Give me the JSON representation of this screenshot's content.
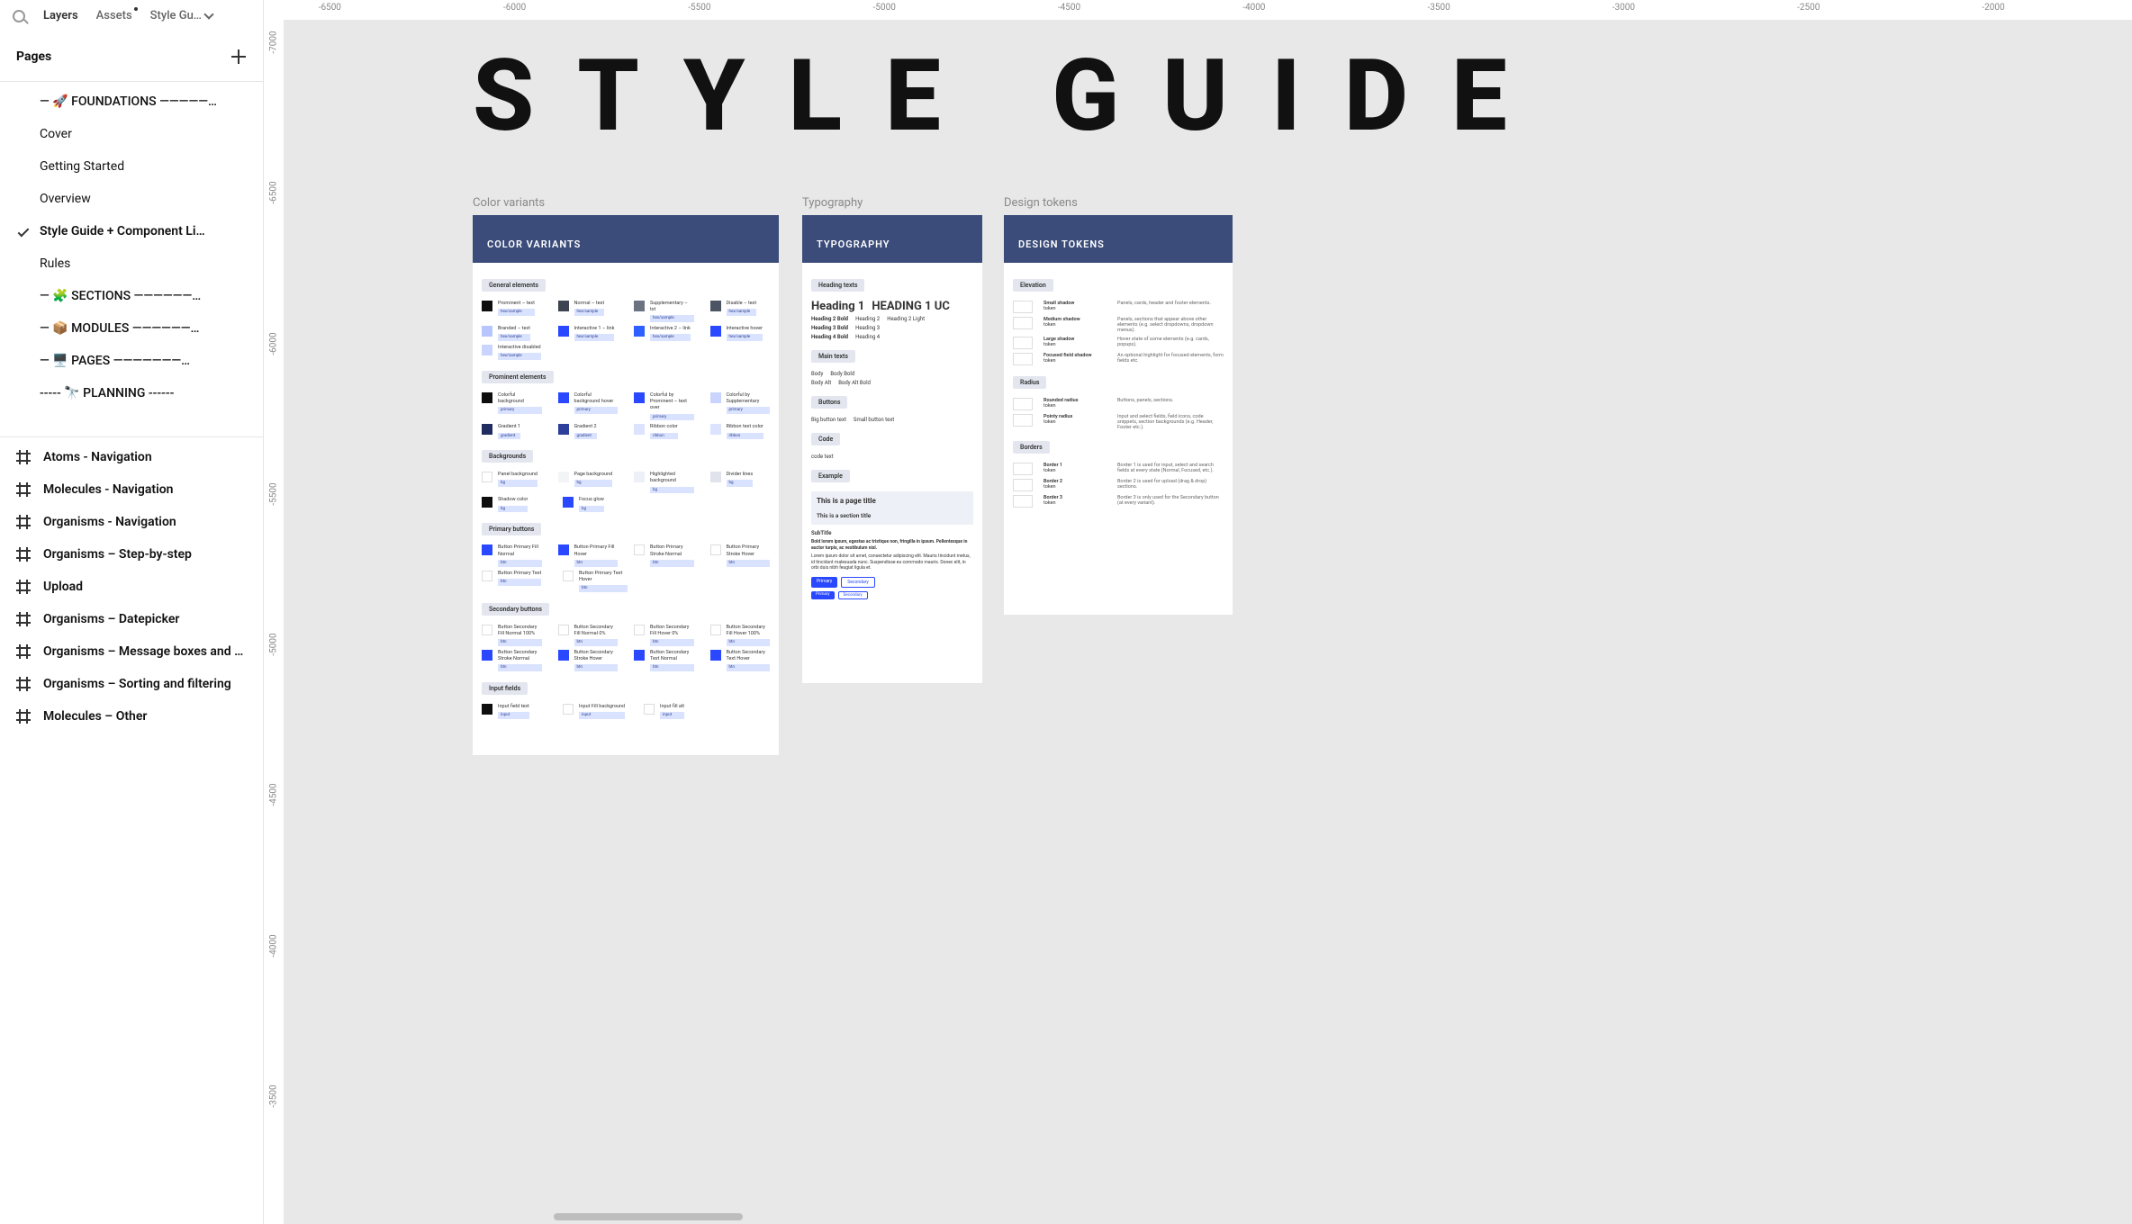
{
  "sidebar": {
    "tabs": {
      "layers": "Layers",
      "assets": "Assets",
      "styleguide": "Style Gu…"
    },
    "pagesHeader": "Pages",
    "pages": [
      {
        "label": "—  🚀  FOUNDATIONS  —————…",
        "section": true
      },
      {
        "label": "Cover"
      },
      {
        "label": "Getting Started"
      },
      {
        "label": "Overview"
      },
      {
        "label": "Style Guide + Component Li…",
        "selected": true
      },
      {
        "label": "Rules"
      },
      {
        "label": "—  🧩  SECTIONS  ——————…",
        "section": true
      },
      {
        "label": "—  📦  MODULES  ——————…",
        "section": true
      },
      {
        "label": "—  🖥️  PAGES  ———————…",
        "section": true
      },
      {
        "label": "-----  🔭  PLANNING  ------",
        "section": true
      }
    ],
    "layers": [
      "Atoms - Navigation",
      "Molecules - Navigation",
      "Organisms - Navigation",
      "Organisms – Step-by-step",
      "Upload",
      "Organisms – Datepicker",
      "Organisms – Message boxes and …",
      "Organisms – Sorting and filtering",
      "Molecules – Other"
    ]
  },
  "rulers": {
    "top": [
      "-6500",
      "-6000",
      "-5500",
      "-5000",
      "-4500",
      "-4000",
      "-3500",
      "-3000",
      "-2500",
      "-2000"
    ],
    "left": [
      "-7000",
      "-6500",
      "-6000",
      "-5500",
      "-5000",
      "-4500",
      "-4000",
      "-3500"
    ]
  },
  "canvas": {
    "title": "STYLE GUIDE",
    "frames": [
      {
        "key": "colorVariants",
        "label": "Color variants",
        "header": "COLOR VARIANTS"
      },
      {
        "key": "typography",
        "label": "Typography",
        "header": "TYPOGRAPHY"
      },
      {
        "key": "designTokens",
        "label": "Design tokens",
        "header": "DESIGN TOKENS"
      }
    ]
  },
  "colorVariants": {
    "groups": [
      {
        "title": "General elements",
        "rows": [
          [
            {
              "chip": "#0e0e0e",
              "name": "Prominent – text",
              "tag": "hex/sample"
            },
            {
              "chip": "#3d4350",
              "name": "Normal – text",
              "tag": "hex/sample"
            },
            {
              "chip": "#6b7280",
              "name": "Supplementary – txt",
              "tag": "hex/sample"
            },
            {
              "chip": "#4b5563",
              "name": "Disable – text",
              "tag": "hex/sample"
            }
          ],
          [
            {
              "chip": "#b8c6ff",
              "name": "Branded – text",
              "tag": "hex/sample"
            },
            {
              "chip": "#2948ff",
              "name": "Interactive 1 – link",
              "tag": "hex/sample"
            },
            {
              "chip": "#2f5fff",
              "name": "Interactive 2 – link",
              "tag": "hex/sample"
            },
            {
              "chip": "#2948ff",
              "name": "Interactive hover",
              "tag": "hex/sample"
            }
          ],
          [
            {
              "chip": "#c9d4ff",
              "name": "Interactive disabled",
              "tag": "hex/sample"
            }
          ]
        ]
      },
      {
        "title": "Prominent elements",
        "rows": [
          [
            {
              "chip": "#0e0e0e",
              "name": "Colorful background",
              "tag": "primary"
            },
            {
              "chip": "#2948ff",
              "name": "Colorful background hover",
              "tag": "primary"
            },
            {
              "chip": "#2948ff",
              "name": "Colorful by Prominent – text over",
              "tag": "primary"
            },
            {
              "chip": "#c9d4ff",
              "name": "Colorful by Supplementary",
              "tag": "primary"
            }
          ],
          [
            {
              "chip": "#202b5f",
              "name": "Gradient 1",
              "tag": "gradient"
            },
            {
              "chip": "#2e3f9b",
              "name": "Gradient 2",
              "tag": "gradient"
            },
            {
              "chip": "#dbe3ff",
              "name": "Ribbon color",
              "tag": "ribbon"
            },
            {
              "chip": "#dbe3ff",
              "name": "Ribbon text color",
              "tag": "ribbon"
            }
          ]
        ]
      },
      {
        "title": "Backgrounds",
        "rows": [
          [
            {
              "chip": "#ffffff",
              "name": "Panel background",
              "tag": "bg"
            },
            {
              "chip": "#f3f4f6",
              "name": "Page background",
              "tag": "bg"
            },
            {
              "chip": "#eef0f7",
              "name": "Highlighted background",
              "tag": "bg"
            },
            {
              "chip": "#e0e3ec",
              "name": "Divider lines",
              "tag": "bg"
            }
          ],
          [
            {
              "chip": "#0e0e0e",
              "name": "Shadow color",
              "tag": "bg"
            },
            {
              "chip": "#2948ff",
              "name": "Focus glow",
              "tag": "bg"
            }
          ]
        ]
      },
      {
        "title": "Primary buttons",
        "rows": [
          [
            {
              "chip": "#2948ff",
              "name": "Button Primary Fill Normal",
              "tag": "btn"
            },
            {
              "chip": "#2948ff",
              "name": "Button Primary Fill Hover",
              "tag": "btn"
            },
            {
              "chip": "#ffffff",
              "name": "Button Primary Stroke Normal",
              "tag": "btn"
            },
            {
              "chip": "#ffffff",
              "name": "Button Primary Stroke Hover",
              "tag": "btn"
            }
          ],
          [
            {
              "chip": "#ffffff",
              "name": "Button Primary Text",
              "tag": "btn"
            },
            {
              "chip": "#ffffff",
              "name": "Button Primary Text Hover",
              "tag": "btn"
            }
          ]
        ]
      },
      {
        "title": "Secondary buttons",
        "rows": [
          [
            {
              "chip": "#ffffff",
              "name": "Button Secondary Fill Normal 100%",
              "tag": "btn"
            },
            {
              "chip": "#ffffff",
              "name": "Button Secondary Fill Normal 0%",
              "tag": "btn"
            },
            {
              "chip": "#ffffff",
              "name": "Button Secondary Fill Hover 0%",
              "tag": "btn"
            },
            {
              "chip": "#ffffff",
              "name": "Button Secondary Fill Hover 100%",
              "tag": "btn"
            }
          ],
          [
            {
              "chip": "#2948ff",
              "name": "Button Secondary Stroke Normal",
              "tag": "btn"
            },
            {
              "chip": "#2948ff",
              "name": "Button Secondary Stroke Hover",
              "tag": "btn"
            },
            {
              "chip": "#2948ff",
              "name": "Button Secondary Text Normal",
              "tag": "btn"
            },
            {
              "chip": "#2948ff",
              "name": "Button Secondary Text Hover",
              "tag": "btn"
            }
          ]
        ]
      },
      {
        "title": "Input fields",
        "rows": [
          [
            {
              "chip": "#0e0e0e",
              "name": "Input field text",
              "tag": "input"
            },
            {
              "chip": "#ffffff",
              "name": "Input Fill background",
              "tag": "input"
            },
            {
              "chip": "#ffffff",
              "name": "Input fill alt",
              "tag": "input"
            }
          ]
        ]
      }
    ]
  },
  "typography": {
    "sections": [
      {
        "title": "Heading texts",
        "lines": [
          {
            "left": "Heading 1",
            "right": "HEADING 1 UC",
            "cls": "typo-h1"
          },
          {
            "left": "Heading 2 Bold",
            "mid": "Heading 2",
            "right": "Heading 2 Light",
            "cls": "typo-small",
            "boldLeft": true
          },
          {
            "left": "Heading 3 Bold",
            "mid": "Heading 3",
            "cls": "typo-small",
            "boldLeft": true
          },
          {
            "left": "Heading 4 Bold",
            "mid": "Heading 4",
            "cls": "typo-small",
            "boldLeft": true
          }
        ]
      },
      {
        "title": "Main texts",
        "lines": [
          {
            "left": "Body",
            "mid": "Body Bold",
            "cls": "typo-small"
          },
          {
            "left": "Body Alt",
            "mid": "Body Alt Bold",
            "cls": "typo-small"
          }
        ]
      },
      {
        "title": "Buttons",
        "lines": [
          {
            "left": "Big button text",
            "mid": "Small button text",
            "cls": "typo-small"
          }
        ]
      },
      {
        "title": "Code",
        "lines": [
          {
            "left": "code text",
            "cls": "typo-small"
          }
        ]
      },
      {
        "title": "Example",
        "example": {
          "pageTitle": "This is a page title",
          "sectionTitle": "This is a section title",
          "subTitle": "SubTitle",
          "bold": "Bold lorem ipsum, egestas ac tristique non, fringilla in ipsum. Pellentesque in auctor turpis, ac vestibulum nisl.",
          "body": "Lorem ipsum dolor sit amet, consectetur adipiscing elit. Mauris tincidunt metus, id tincidunt malesuada nunc. Suspendisse eu commodo mauris. Donec elit, in orbi duis nibh feugiat ligula et.",
          "primaryBtn": "Primary",
          "secondaryBtn": "Secondary",
          "primaryBtn2": "Primary",
          "secondaryBtn2": "Secondary"
        }
      }
    ]
  },
  "designTokens": {
    "groups": [
      {
        "title": "Elevation",
        "rows": [
          {
            "name": "Small shadow",
            "tag": "token",
            "desc": "Panels, cards, header and footer elements."
          },
          {
            "name": "Medium shadow",
            "tag": "token",
            "desc": "Panels, sections that appear above other elements (e.g. select dropdowns, dropdown menus)."
          },
          {
            "name": "Large shadow",
            "tag": "token",
            "desc": "Hover state of some elements (e.g. cards, popups)."
          },
          {
            "name": "Focused field shadow",
            "tag": "token",
            "desc": "An optional highlight for focused elements, form fields etc."
          }
        ]
      },
      {
        "title": "Radius",
        "rows": [
          {
            "name": "Rounded radius",
            "tag": "token",
            "desc": "Buttons, panels, sections."
          },
          {
            "name": "Pointy radius",
            "tag": "token",
            "desc": "Input and select fields, field icons, code snippets, section backgrounds (e.g. Header, Footer etc.)."
          }
        ]
      },
      {
        "title": "Borders",
        "rows": [
          {
            "name": "Border 1",
            "tag": "token",
            "desc": "Border 1 is used for input, select and search fields at every state (Normal, Focused, etc.)."
          },
          {
            "name": "Border 2",
            "tag": "token",
            "desc": "Border 2 is used for upload (drag & drop) sections."
          },
          {
            "name": "Border 3",
            "tag": "token",
            "desc": "Border 3 is only used for the Secondary button (at every variant)."
          }
        ]
      }
    ]
  }
}
